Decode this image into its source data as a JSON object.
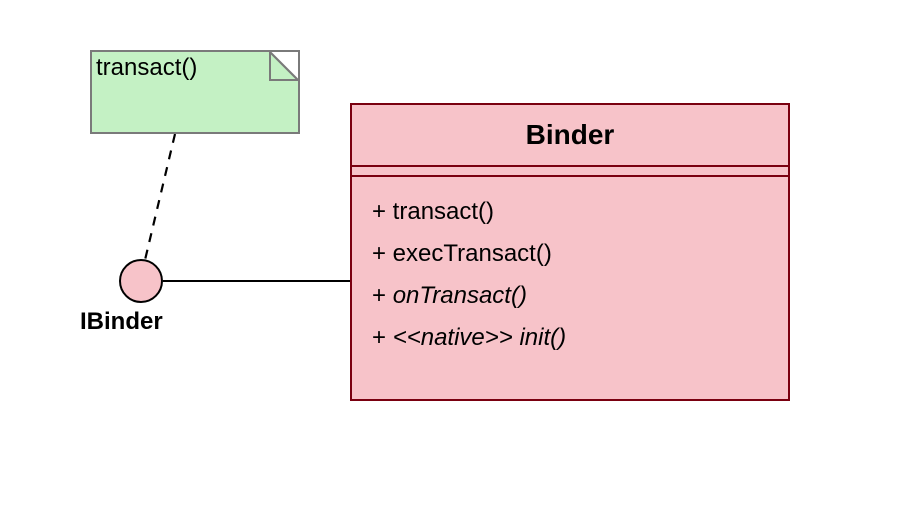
{
  "note": {
    "text": "transact()"
  },
  "interface": {
    "label": "IBinder"
  },
  "class": {
    "name": "Binder",
    "operations": [
      {
        "text": "+ transact()",
        "italic": false
      },
      {
        "text": "+ execTransact()",
        "italic": false
      },
      {
        "text": "+ onTransact()",
        "italic": true
      },
      {
        "text": "+ <<native>> init()",
        "italic": true
      }
    ]
  }
}
